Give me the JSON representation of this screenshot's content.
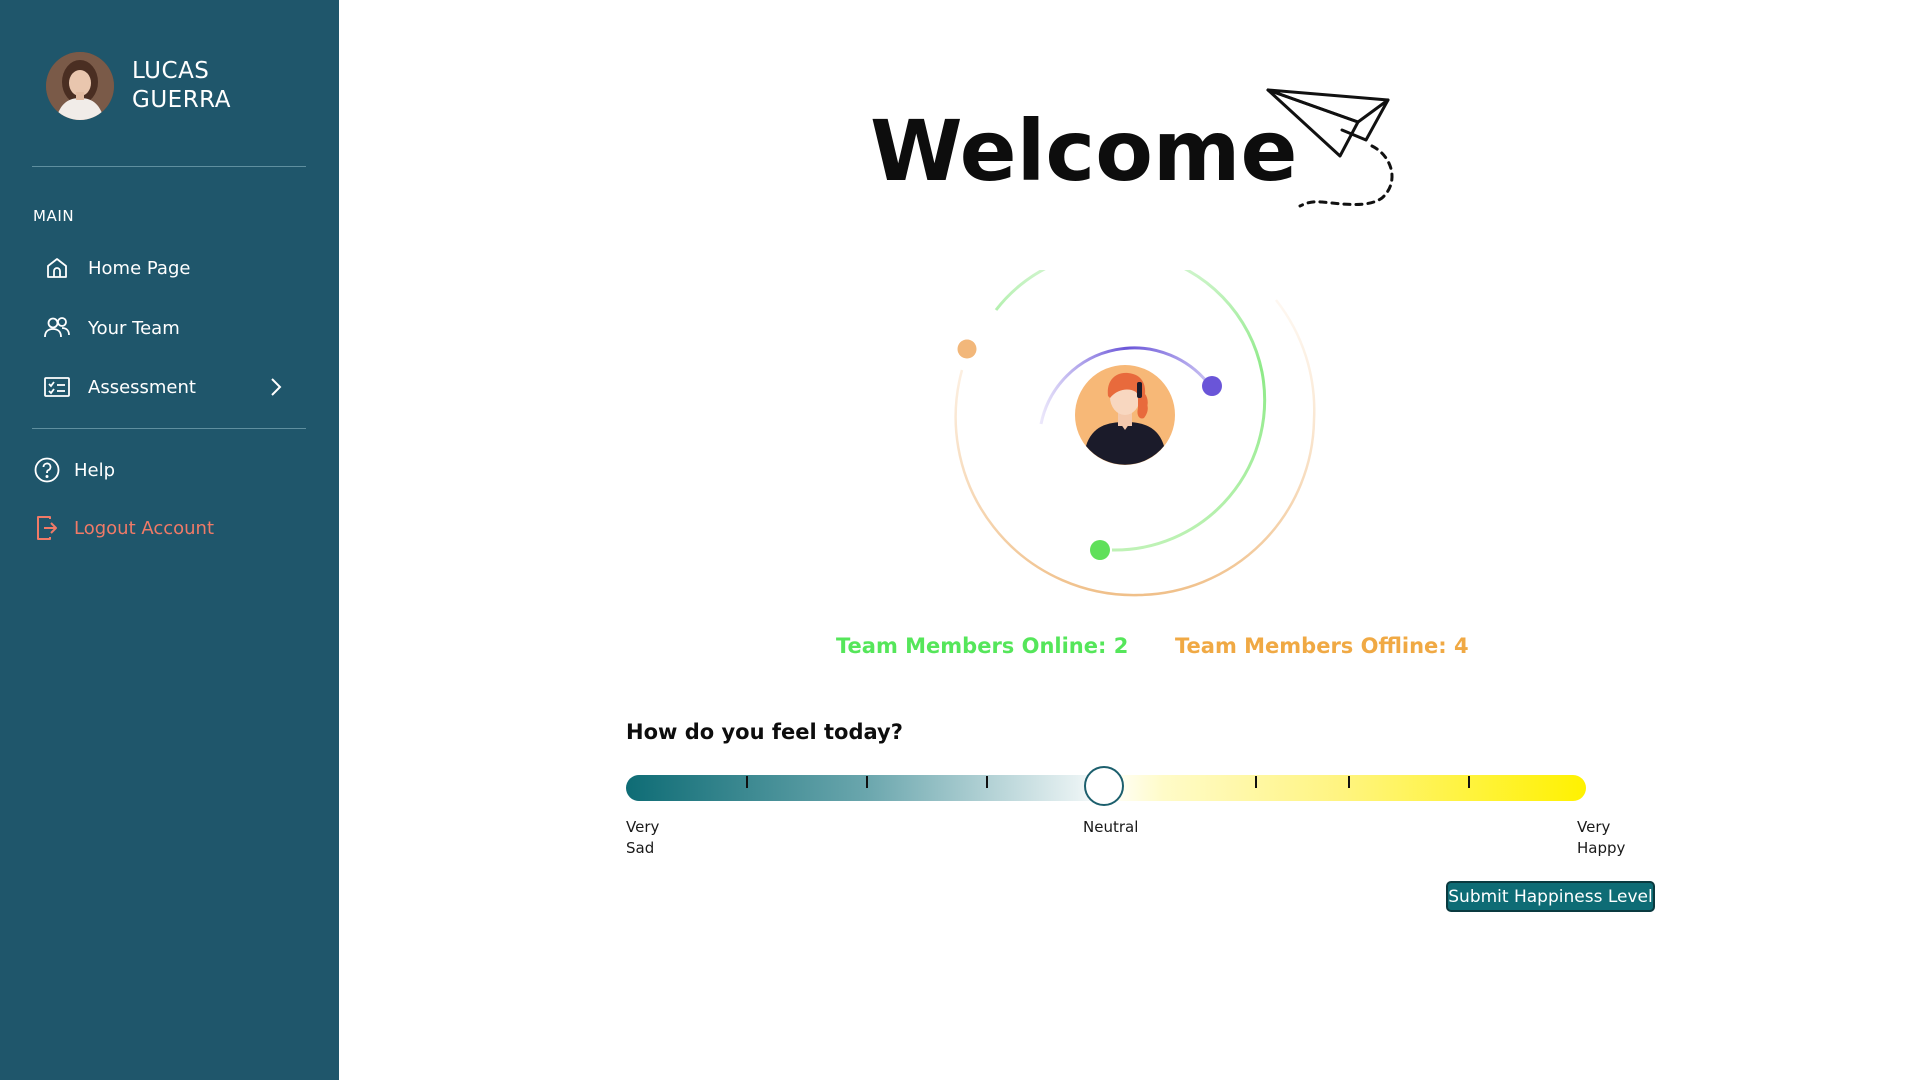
{
  "sidebar": {
    "profile": {
      "first_name": "LUCAS",
      "last_name": "GUERRA"
    },
    "section_main": "MAIN",
    "items": [
      {
        "label": "Home Page",
        "icon": "home-icon"
      },
      {
        "label": "Your Team",
        "icon": "team-icon"
      },
      {
        "label": "Assessment",
        "icon": "checklist-icon"
      },
      {
        "label": "Help",
        "icon": "help-icon"
      },
      {
        "label": "Logout Account",
        "icon": "logout-icon"
      }
    ],
    "colors": {
      "background": "#1f566b",
      "logout": "#f07a67"
    }
  },
  "main": {
    "title": "Welcome",
    "stats": {
      "online": "Team Members Online: 2",
      "offline": "Team Members Offline: 4"
    },
    "mood": {
      "question": "How do you feel today?",
      "label_min_line1": "Very",
      "label_min_line2": "Sad",
      "label_mid": "Neutral",
      "label_max_line1": "Very",
      "label_max_line2": "Happy",
      "current_value": 0.5,
      "submit": "Submit Happiness Level"
    },
    "colors": {
      "online": "#55e65a",
      "offline": "#f0a944",
      "accent": "#0e6c75",
      "orbit_purple": "#6a55d8"
    }
  }
}
